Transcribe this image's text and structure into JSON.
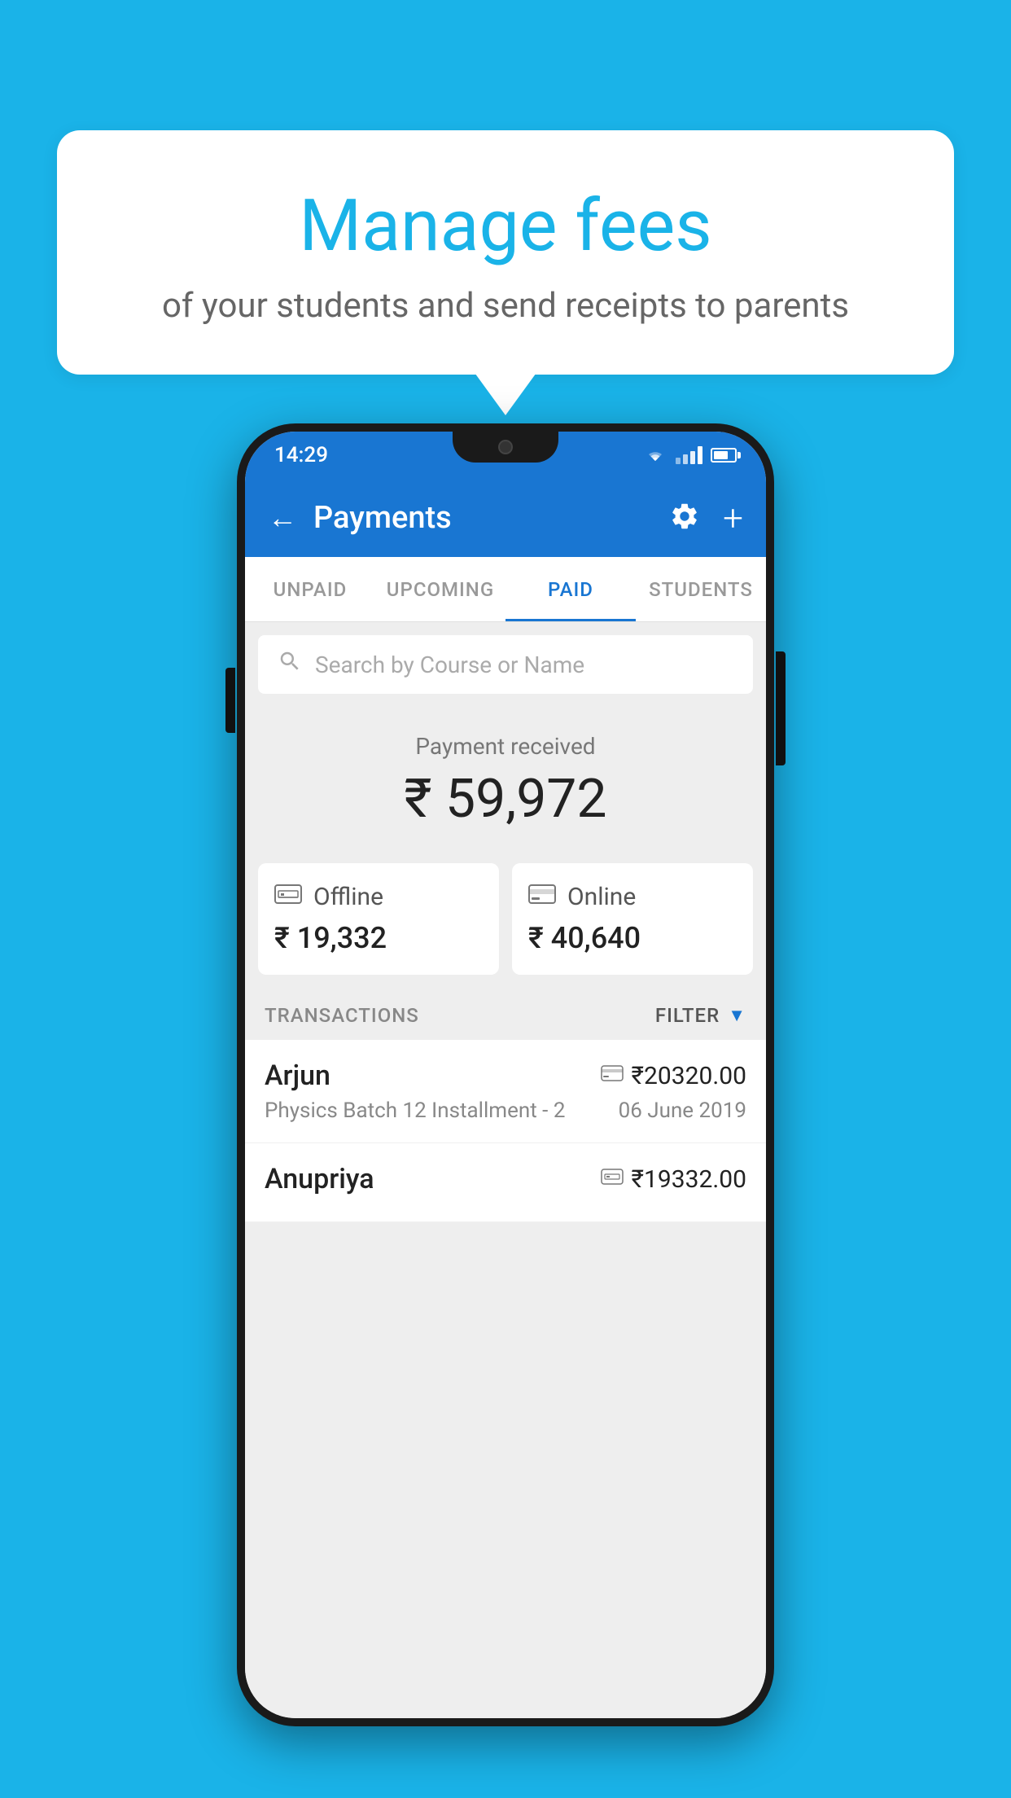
{
  "background_color": "#1ab3e8",
  "speech_bubble": {
    "title": "Manage fees",
    "subtitle": "of your students and send receipts to parents"
  },
  "status_bar": {
    "time": "14:29"
  },
  "app_bar": {
    "title": "Payments",
    "back_label": "←",
    "add_label": "+"
  },
  "tabs": [
    {
      "id": "unpaid",
      "label": "UNPAID",
      "active": false
    },
    {
      "id": "upcoming",
      "label": "UPCOMING",
      "active": false
    },
    {
      "id": "paid",
      "label": "PAID",
      "active": true
    },
    {
      "id": "students",
      "label": "STUDENTS",
      "active": false
    }
  ],
  "search": {
    "placeholder": "Search by Course or Name"
  },
  "payment_summary": {
    "label": "Payment received",
    "amount": "₹ 59,972",
    "offline_label": "Offline",
    "offline_amount": "₹ 19,332",
    "online_label": "Online",
    "online_amount": "₹ 40,640"
  },
  "transactions_section": {
    "label": "TRANSACTIONS",
    "filter_label": "FILTER"
  },
  "transactions": [
    {
      "name": "Arjun",
      "amount": "₹20320.00",
      "mode": "card",
      "course": "Physics Batch 12 Installment - 2",
      "date": "06 June 2019"
    },
    {
      "name": "Anupriya",
      "amount": "₹19332.00",
      "mode": "cash",
      "course": "",
      "date": ""
    }
  ]
}
